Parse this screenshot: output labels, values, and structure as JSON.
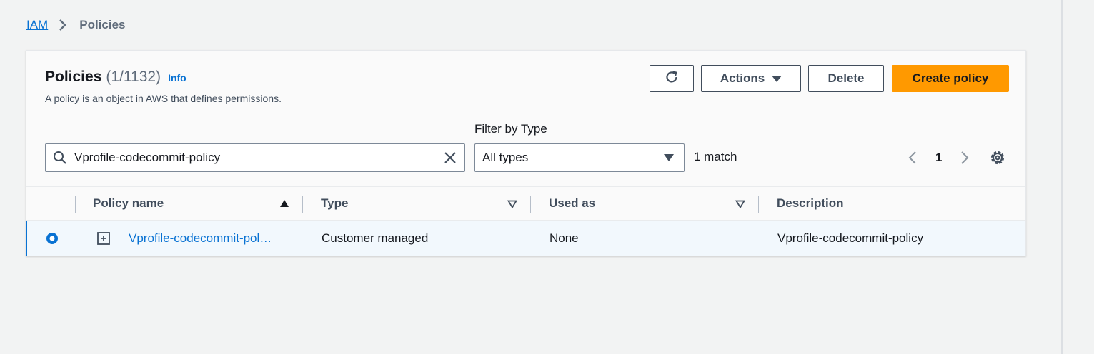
{
  "breadcrumb": {
    "root": "IAM",
    "current": "Policies"
  },
  "header": {
    "title": "Policies",
    "count": "(1/1132)",
    "info": "Info",
    "subtitle": "A policy is an object in AWS that defines permissions."
  },
  "toolbar": {
    "actions_label": "Actions",
    "delete_label": "Delete",
    "create_label": "Create policy"
  },
  "filter": {
    "search_value": "Vprofile-codecommit-policy",
    "type_label": "Filter by Type",
    "type_value": "All types",
    "match_text": "1 match"
  },
  "pagination": {
    "current_page": "1"
  },
  "table": {
    "columns": [
      "Policy name",
      "Type",
      "Used as",
      "Description"
    ],
    "rows": [
      {
        "policy_name": "Vprofile-codecommit-pol…",
        "type": "Customer managed",
        "used_as": "None",
        "description": "Vprofile-codecommit-policy",
        "selected": true
      }
    ]
  },
  "colors": {
    "primary_button": "#ff9900",
    "link": "#0972d3",
    "selected_row_bg": "#f2f8fd"
  },
  "icons": [
    "chevron-right-icon",
    "refresh-icon",
    "caret-down-icon",
    "search-icon",
    "clear-icon",
    "chevron-left-icon",
    "settings-icon",
    "sort-ascending-icon",
    "sort-descending-icon",
    "radio-selected-icon",
    "expand-icon"
  ]
}
